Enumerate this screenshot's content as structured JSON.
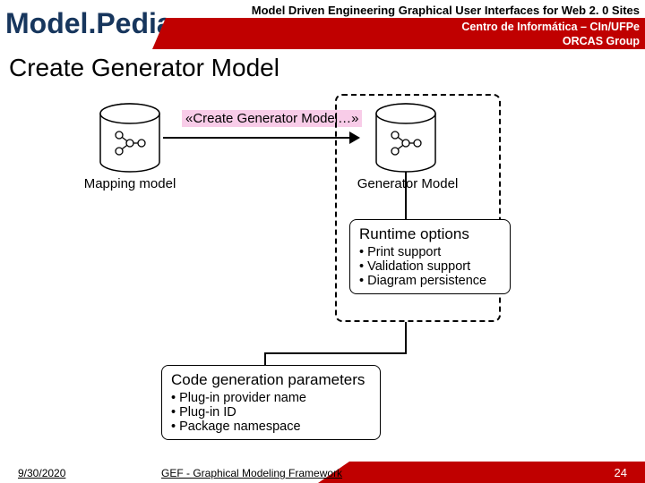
{
  "header": {
    "logo": "Model.Pedia",
    "title": "Model Driven Engineering Graphical User Interfaces for Web 2. 0 Sites",
    "org1": "Centro de Informática – CIn/UFPe",
    "org2": "ORCAS Group"
  },
  "slide_title": "Create Generator Model",
  "diagram": {
    "mapping_label": "Mapping model",
    "generator_label": "Generator Model",
    "action_label": "«Create Generator Model…»",
    "runtime": {
      "title": "Runtime options",
      "items": [
        "Print support",
        "Validation support",
        "Diagram persistence"
      ]
    },
    "codegen": {
      "title": "Code generation parameters",
      "items": [
        "Plug-in provider name",
        "Plug-in ID",
        "Package namespace"
      ]
    }
  },
  "footer": {
    "date": "9/30/2020",
    "mid": "GEF - Graphical Modeling Framework",
    "page": "24"
  }
}
